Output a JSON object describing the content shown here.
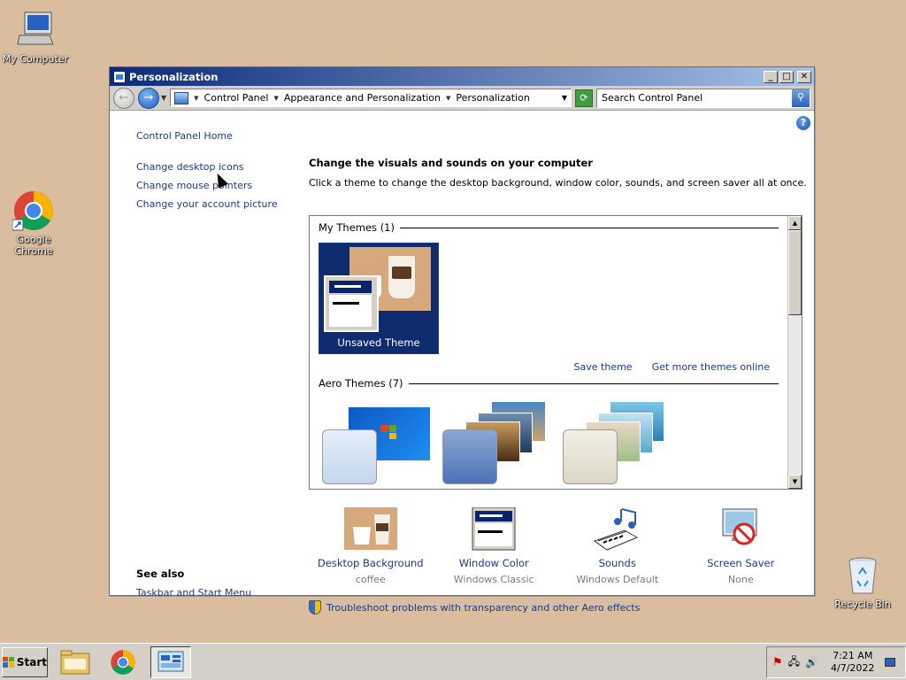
{
  "desktop": {
    "icons": [
      {
        "label": "My Computer"
      },
      {
        "label": "Google Chrome"
      },
      {
        "label": "Recycle Bin"
      }
    ]
  },
  "window": {
    "title": "Personalization",
    "controls": {
      "minimize": "_",
      "maximize": "□",
      "close": "✕"
    }
  },
  "addressbar": {
    "crumbs": [
      "Control Panel",
      "Appearance and Personalization",
      "Personalization"
    ],
    "search_placeholder": "Search Control Panel"
  },
  "sidebar": {
    "home": "Control Panel Home",
    "links": [
      "Change desktop icons",
      "Change mouse pointers",
      "Change your account picture"
    ],
    "see_also_title": "See also",
    "see_also_links": [
      "Taskbar and Start Menu"
    ]
  },
  "main": {
    "heading": "Change the visuals and sounds on your computer",
    "subtext": "Click a theme to change the desktop background, window color, sounds, and screen saver all at once.",
    "my_themes_title": "My Themes (1)",
    "unsaved_theme_label": "Unsaved Theme",
    "save_theme": "Save theme",
    "get_more_themes": "Get more themes online",
    "aero_themes_title": "Aero Themes (7)",
    "settings": [
      {
        "label": "Desktop Background",
        "value": "coffee"
      },
      {
        "label": "Window Color",
        "value": "Windows Classic"
      },
      {
        "label": "Sounds",
        "value": "Windows Default"
      },
      {
        "label": "Screen Saver",
        "value": "None"
      }
    ],
    "troubleshoot": "Troubleshoot problems with transparency and other Aero effects"
  },
  "taskbar": {
    "start_label": "Start",
    "time": "7:21 AM",
    "date": "4/7/2022"
  },
  "colors": {
    "link": "#1a3a8c",
    "desktop": "#d9bd9e",
    "title_gradient_start": "#0b2a78"
  }
}
